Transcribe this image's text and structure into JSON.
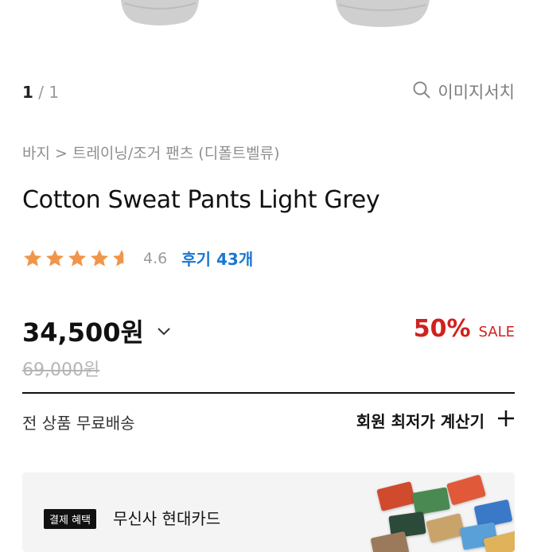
{
  "gallery": {
    "current": "1",
    "separator": " / ",
    "total": "1",
    "image_search_label": "이미지서치"
  },
  "product": {
    "breadcrumb": "바지 > 트레이닝/조거 팬츠 (디폴트벨류)",
    "title": "Cotton Sweat Pants Light Grey",
    "rating": 4.6,
    "rating_text": "4.6",
    "reviews_label": "후기 43개",
    "price": "34,500원",
    "original_price": "69,000원",
    "discount_percent": "50%",
    "sale_label": "SALE"
  },
  "shipping": {
    "label": "전 상품 무료배송"
  },
  "member_calc": {
    "label": "회원 최저가 계산기"
  },
  "benefit_banner": {
    "badge": "결제 혜택",
    "card_name": "무신사 현대카드"
  },
  "colors": {
    "star": "#f0954a",
    "review_link": "#1a77d2",
    "discount": "#d0211f",
    "banner_bg": "#f4f4f4"
  }
}
